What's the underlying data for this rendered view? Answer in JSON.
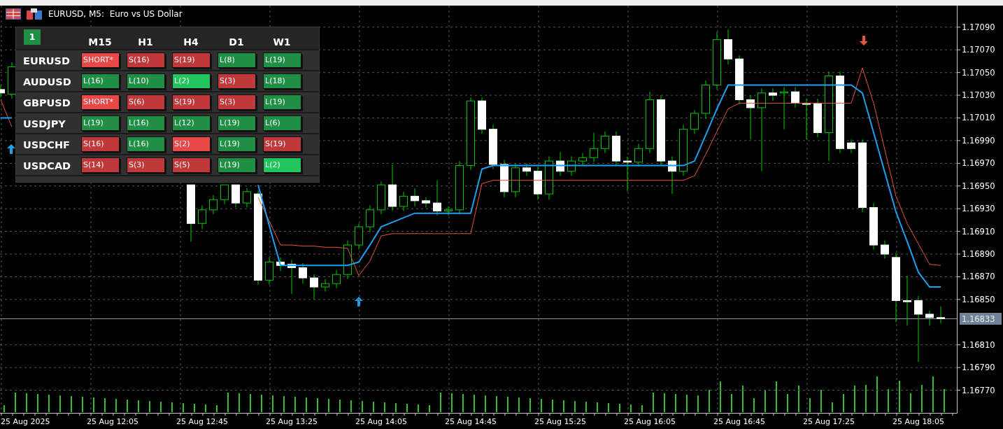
{
  "window": {
    "title": "EURUSD, M5:  Euro vs US Dollar"
  },
  "panel": {
    "page": "1",
    "columns": [
      "M15",
      "H1",
      "H4",
      "D1",
      "W1"
    ],
    "rows": [
      {
        "symbol": "EURUSD",
        "cells": [
          {
            "text": "SHORT*",
            "color": "#e84848"
          },
          {
            "text": "S(16)",
            "color": "#c0383a"
          },
          {
            "text": "S(19)",
            "color": "#c0383a"
          },
          {
            "text": "L(8)",
            "color": "#1e8f44"
          },
          {
            "text": "L(19)",
            "color": "#1e8f44"
          }
        ]
      },
      {
        "symbol": "AUDUSD",
        "cells": [
          {
            "text": "L(16)",
            "color": "#1e8f44"
          },
          {
            "text": "L(10)",
            "color": "#1e8f44"
          },
          {
            "text": "L(2)",
            "color": "#22c45e"
          },
          {
            "text": "S(3)",
            "color": "#c0383a"
          },
          {
            "text": "L(18)",
            "color": "#1e8f44"
          }
        ]
      },
      {
        "symbol": "GBPUSD",
        "cells": [
          {
            "text": "SHORT*",
            "color": "#e84848"
          },
          {
            "text": "S(6)",
            "color": "#c0383a"
          },
          {
            "text": "S(19)",
            "color": "#c0383a"
          },
          {
            "text": "S(3)",
            "color": "#c0383a"
          },
          {
            "text": "L(19)",
            "color": "#1e8f44"
          }
        ]
      },
      {
        "symbol": "USDJPY",
        "cells": [
          {
            "text": "L(19)",
            "color": "#1e8f44"
          },
          {
            "text": "L(16)",
            "color": "#1e8f44"
          },
          {
            "text": "L(12)",
            "color": "#1e8f44"
          },
          {
            "text": "L(19)",
            "color": "#1e8f44"
          },
          {
            "text": "L(6)",
            "color": "#1e8f44"
          }
        ]
      },
      {
        "symbol": "USDCHF",
        "cells": [
          {
            "text": "S(16)",
            "color": "#c0383a"
          },
          {
            "text": "L(16)",
            "color": "#1e8f44"
          },
          {
            "text": "S(2)",
            "color": "#e84848"
          },
          {
            "text": "L(19)",
            "color": "#1e8f44"
          },
          {
            "text": "S(19)",
            "color": "#c0383a"
          }
        ]
      },
      {
        "symbol": "USDCAD",
        "cells": [
          {
            "text": "S(14)",
            "color": "#c0383a"
          },
          {
            "text": "S(3)",
            "color": "#c0383a"
          },
          {
            "text": "S(5)",
            "color": "#c0383a"
          },
          {
            "text": "L(19)",
            "color": "#1e8f44"
          },
          {
            "text": "L(2)",
            "color": "#22c45e"
          }
        ]
      }
    ]
  },
  "chart": {
    "current_price": "1.16833",
    "chart_data": {
      "type": "candlestick",
      "grid": true,
      "categories": [
        null,
        null,
        "25 Aug 2025",
        null,
        null,
        null,
        null,
        null,
        null,
        null,
        "25 Aug 12:05",
        null,
        null,
        null,
        null,
        null,
        null,
        null,
        "25 Aug 12:45",
        null,
        null,
        null,
        null,
        null,
        null,
        null,
        "25 Aug 13:25",
        null,
        null,
        null,
        null,
        null,
        null,
        null,
        "25 Aug 14:05",
        null,
        null,
        null,
        null,
        null,
        null,
        null,
        "25 Aug 14:45",
        null,
        null,
        null,
        null,
        null,
        null,
        null,
        "25 Aug 15:25",
        null,
        null,
        null,
        null,
        null,
        null,
        null,
        "25 Aug 16:05",
        null,
        null,
        null,
        null,
        null,
        null,
        null,
        "25 Aug 16:45",
        null,
        null,
        null,
        null,
        null,
        null,
        null,
        "25 Aug 17:25",
        null,
        null,
        null,
        null,
        null,
        null,
        null,
        "25 Aug 18:05",
        null,
        null
      ],
      "ohlc": [
        [
          1.17035,
          1.17039,
          1.17028,
          1.17032
        ],
        [
          1.17031,
          1.17059,
          1.17027,
          1.17055
        ],
        null,
        null,
        null,
        null,
        null,
        null,
        null,
        null,
        null,
        null,
        null,
        null,
        null,
        null,
        null,
        [
          1.16951,
          1.16951,
          1.16901,
          1.16917
        ],
        [
          1.16917,
          1.16933,
          1.16912,
          1.16929
        ],
        [
          1.16929,
          1.16942,
          1.16925,
          1.16938
        ],
        [
          1.16938,
          1.16951,
          1.16934,
          1.16951
        ],
        [
          1.16951,
          1.16951,
          1.16931,
          1.16935
        ],
        [
          1.16935,
          1.16948,
          1.16931,
          1.16945
        ],
        [
          1.16943,
          1.16946,
          1.16863,
          1.16867
        ],
        [
          1.16867,
          1.16887,
          1.16863,
          1.16883
        ],
        [
          1.16883,
          1.16887,
          1.16875,
          1.1688
        ],
        [
          1.16881,
          1.16885,
          1.16855,
          1.16878
        ],
        [
          1.16878,
          1.16882,
          1.16864,
          1.16869
        ],
        [
          1.16869,
          1.16872,
          1.1685,
          1.16861
        ],
        [
          1.16861,
          1.16868,
          1.16857,
          1.16864
        ],
        [
          1.16864,
          1.16876,
          1.1686,
          1.16872
        ],
        [
          1.16872,
          1.16902,
          1.16868,
          1.16898
        ],
        [
          1.16898,
          1.16917,
          1.16894,
          1.16914
        ],
        [
          1.16914,
          1.16933,
          1.16909,
          1.16929
        ],
        [
          1.16929,
          1.16954,
          1.16925,
          1.16951
        ],
        [
          1.16951,
          1.16969,
          1.16928,
          1.16932
        ],
        [
          1.16932,
          1.16945,
          1.16928,
          1.16941
        ],
        [
          1.16941,
          1.16948,
          1.16932,
          1.16937
        ],
        [
          1.16937,
          1.1694,
          1.16931,
          1.16935
        ],
        [
          1.16935,
          1.16955,
          1.16924,
          1.16928
        ],
        [
          1.16928,
          1.16932,
          1.16924,
          1.16929
        ],
        [
          1.16929,
          1.16972,
          1.16925,
          1.16968
        ],
        [
          1.16968,
          1.17028,
          1.16964,
          1.17025
        ],
        [
          1.17025,
          1.17028,
          1.16996,
          1.17
        ],
        [
          1.17,
          1.17004,
          1.16965,
          1.16969
        ],
        [
          1.16969,
          1.16973,
          1.1694,
          1.16945
        ],
        [
          1.16945,
          1.1697,
          1.1694,
          1.16966
        ],
        [
          1.16966,
          1.1697,
          1.16959,
          1.16963
        ],
        [
          1.16963,
          1.16967,
          1.16938,
          1.16943
        ],
        [
          1.16943,
          1.16976,
          1.16938,
          1.16972
        ],
        [
          1.16972,
          1.1698,
          1.16959,
          1.16963
        ],
        [
          1.16963,
          1.16976,
          1.16959,
          1.16972
        ],
        [
          1.16972,
          1.16979,
          1.16968,
          1.16975
        ],
        [
          1.16975,
          1.16997,
          1.16971,
          1.16983
        ],
        [
          1.16983,
          1.16998,
          1.16979,
          1.16994
        ],
        [
          1.16994,
          1.16998,
          1.16968,
          1.16972
        ],
        [
          1.16972,
          1.16976,
          1.16945,
          1.16971
        ],
        [
          1.16971,
          1.16987,
          1.16967,
          1.16983
        ],
        [
          1.16983,
          1.17033,
          1.16979,
          1.17026
        ],
        [
          1.17026,
          1.1703,
          1.16968,
          1.16972
        ],
        [
          1.16972,
          1.16976,
          1.16943,
          1.16963
        ],
        [
          1.16963,
          1.17004,
          1.16959,
          1.17
        ],
        [
          1.17,
          1.17017,
          1.16996,
          1.17014
        ],
        [
          1.17014,
          1.17043,
          1.17009,
          1.17039
        ],
        [
          1.17039,
          1.17086,
          1.17035,
          1.17079
        ],
        [
          1.17079,
          1.17088,
          1.17057,
          1.17062
        ],
        [
          1.17062,
          1.17065,
          1.17022,
          1.17026
        ],
        [
          1.17026,
          1.1703,
          1.16991,
          1.17019
        ],
        [
          1.17019,
          1.17036,
          1.16963,
          1.17032
        ],
        [
          1.17032,
          1.17036,
          1.17025,
          1.1703
        ],
        [
          1.17032,
          1.17037,
          1.17,
          1.17033
        ],
        [
          1.17033,
          1.17037,
          1.17019,
          1.17023
        ],
        [
          1.17023,
          1.17027,
          1.16991,
          1.17022
        ],
        [
          1.17023,
          1.17027,
          1.16993,
          1.16997
        ],
        [
          1.16997,
          1.17051,
          1.16972,
          1.17047
        ],
        [
          1.17047,
          1.17051,
          1.16979,
          1.16983
        ],
        [
          1.16988,
          1.16991,
          1.16979,
          1.16983
        ],
        [
          1.16988,
          1.16991,
          1.16927,
          1.16931
        ],
        [
          1.16931,
          1.16935,
          1.16894,
          1.16898
        ],
        [
          1.16898,
          1.16902,
          1.16886,
          1.1689
        ],
        [
          1.16887,
          1.16891,
          1.1683,
          1.16849
        ],
        [
          1.16849,
          1.16871,
          1.16827,
          1.16848
        ],
        [
          1.16849,
          1.16853,
          1.16795,
          1.16837
        ],
        [
          1.16837,
          1.1684,
          1.16827,
          1.16834
        ],
        [
          1.16834,
          1.16844,
          1.16829,
          1.16833
        ]
      ],
      "series": [
        {
          "type": "line",
          "color": "#1ea0ef",
          "values": [
            1.1701,
            1.1701,
            null,
            null,
            null,
            null,
            null,
            null,
            null,
            null,
            null,
            null,
            null,
            null,
            null,
            null,
            null,
            null,
            null,
            null,
            null,
            null,
            null,
            1.16951,
            1.16915,
            1.1688,
            1.1688,
            1.1688,
            1.1688,
            1.1688,
            1.1688,
            1.1688,
            1.16883,
            1.16898,
            1.16914,
            1.16918,
            1.16922,
            1.16926,
            1.16926,
            1.16926,
            1.16926,
            1.16926,
            1.16926,
            1.16965,
            1.16968,
            1.16968,
            1.16968,
            1.16968,
            1.16968,
            1.16968,
            1.16968,
            1.16968,
            1.16968,
            1.16968,
            1.16968,
            1.16968,
            1.16968,
            1.16968,
            1.16968,
            1.16968,
            1.16968,
            1.16968,
            1.16972,
            1.16995,
            1.17018,
            1.17039,
            1.17039,
            1.17039,
            1.17039,
            1.17039,
            1.17039,
            1.17039,
            1.17039,
            1.17039,
            1.17039,
            1.17039,
            1.17039,
            1.17032,
            1.16997,
            1.16962,
            1.16927,
            1.16901,
            1.16874,
            1.16861,
            1.16861
          ]
        },
        {
          "type": "line",
          "color": "#e8553a",
          "values": [
            1.17026,
            1.17002,
            null,
            null,
            null,
            null,
            null,
            null,
            null,
            null,
            null,
            null,
            null,
            null,
            null,
            null,
            null,
            null,
            null,
            null,
            null,
            null,
            null,
            1.1694,
            1.16919,
            1.16898,
            1.16898,
            1.16897,
            1.16897,
            1.16896,
            1.16896,
            1.16895,
            1.16871,
            1.16884,
            1.16906,
            1.16908,
            1.16908,
            1.16908,
            1.16908,
            1.16908,
            1.16908,
            1.16908,
            1.16908,
            1.16952,
            1.16955,
            1.16955,
            1.16955,
            1.16955,
            1.16955,
            1.16955,
            1.16955,
            1.16955,
            1.16955,
            1.16955,
            1.16955,
            1.16955,
            1.16955,
            1.16955,
            1.16955,
            1.16955,
            1.16955,
            1.16955,
            1.16959,
            1.16978,
            1.16998,
            1.17018,
            1.17023,
            1.17023,
            1.17023,
            1.17023,
            1.17023,
            1.17023,
            1.17023,
            1.17023,
            1.17023,
            1.17023,
            1.17023,
            1.17054,
            1.17023,
            1.16982,
            1.16941,
            1.16917,
            1.16899,
            1.16881,
            1.1688
          ]
        }
      ],
      "ylim": [
        1.1675,
        1.17109
      ],
      "yticks": [
        {
          "value": 1.1709,
          "label": "1.17090"
        },
        {
          "value": 1.1707,
          "label": "1.17070"
        },
        {
          "value": 1.1705,
          "label": "1.17050"
        },
        {
          "value": 1.1703,
          "label": "1.17030"
        },
        {
          "value": 1.1701,
          "label": "1.17010"
        },
        {
          "value": 1.1699,
          "label": "1.16990"
        },
        {
          "value": 1.1697,
          "label": "1.16970"
        },
        {
          "value": 1.1695,
          "label": "1.16950"
        },
        {
          "value": 1.1693,
          "label": "1.16930"
        },
        {
          "value": 1.1691,
          "label": "1.16910"
        },
        {
          "value": 1.1689,
          "label": "1.16890"
        },
        {
          "value": 1.1687,
          "label": "1.16870"
        },
        {
          "value": 1.1685,
          "label": "1.16850"
        },
        {
          "value": 1.1681,
          "label": "1.16810"
        },
        {
          "value": 1.1679,
          "label": "1.16790"
        },
        {
          "value": 1.1677,
          "label": "1.16770"
        }
      ]
    }
  }
}
